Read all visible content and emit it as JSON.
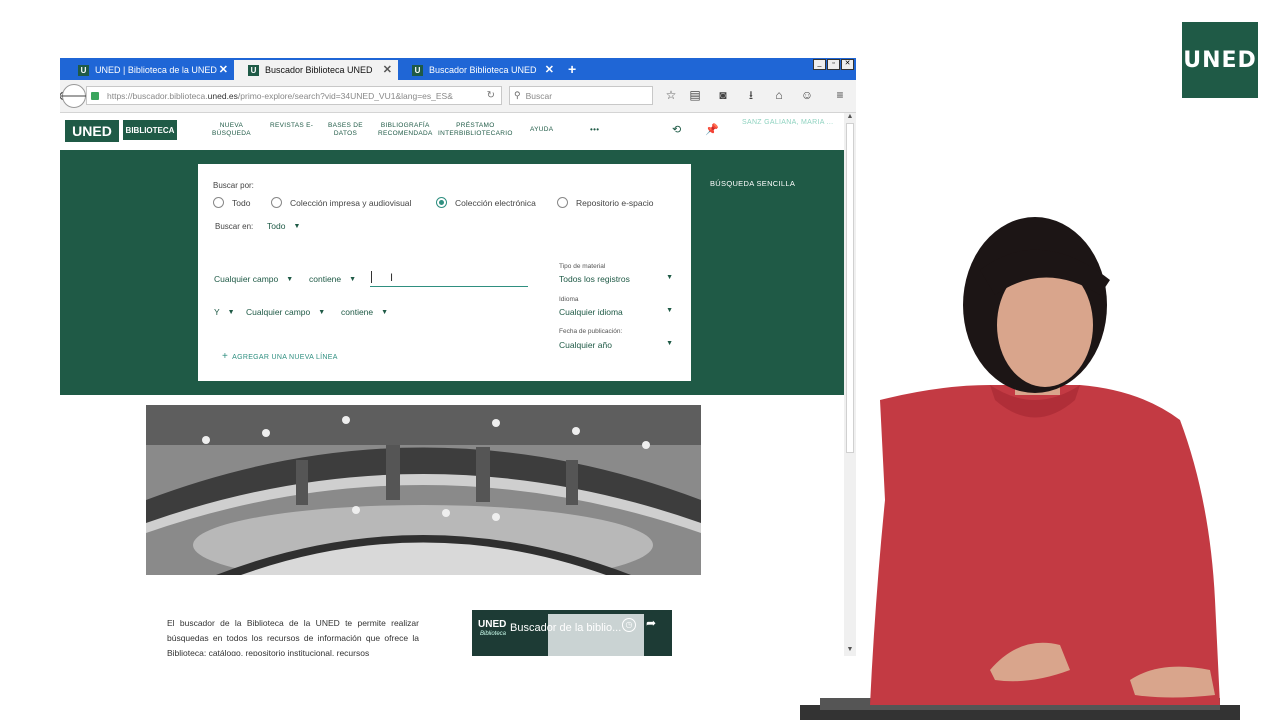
{
  "corner_logo": {
    "text": "UNED"
  },
  "browser": {
    "tabs": [
      {
        "label": "UNED | Biblioteca de la UNED",
        "favicon": "U",
        "close": "✕"
      },
      {
        "label": "Buscador Biblioteca UNED",
        "favicon": "U",
        "close": "✕"
      },
      {
        "label": "Buscador Biblioteca UNED",
        "favicon": "U",
        "close": "✕"
      }
    ],
    "new_tab": "+",
    "url_prefix": "https://buscador.biblioteca.",
    "url_domain": "uned.es",
    "url_suffix": "/primo-explore/search?vid=34UNED_VU1&lang=es_ES&",
    "search_placeholder": "Buscar"
  },
  "header": {
    "logo_uned": "UNED",
    "logo_biblioteca": "BIBLIOTECA",
    "nav": [
      {
        "line1": "NUEVA",
        "line2": "BÚSQUEDA"
      },
      {
        "line1": "REVISTAS E-",
        "line2": ""
      },
      {
        "line1": "BASES DE",
        "line2": "DATOS"
      },
      {
        "line1": "BIBLIOGRAFÍA",
        "line2": "RECOMENDADA"
      },
      {
        "line1": "PRÉSTAMO",
        "line2": "INTERBIBLIOTECARIO"
      },
      {
        "line1": "AYUDA",
        "line2": ""
      }
    ],
    "more": "•••",
    "user": "SANZ GALIANA, MARIA ..."
  },
  "search": {
    "buscar_por_label": "Buscar por:",
    "scopes": [
      {
        "label": "Todo",
        "selected": false
      },
      {
        "label": "Colección impresa y audiovisual",
        "selected": false
      },
      {
        "label": "Colección electrónica",
        "selected": true
      },
      {
        "label": "Repositorio e-spacio",
        "selected": false
      }
    ],
    "buscar_en_label": "Buscar en:",
    "buscar_en_value": "Todo",
    "row1": {
      "field": "Cualquier campo",
      "operator": "contiene",
      "value": ""
    },
    "row2": {
      "boolean": "Y",
      "field": "Cualquier campo",
      "operator": "contiene"
    },
    "add_line": "AGREGAR UNA NUEVA LÍNEA",
    "material_label": "Tipo de material",
    "material_value": "Todos los registros",
    "language_label": "Idioma",
    "language_value": "Cualquier idioma",
    "date_label": "Fecha de publicación:",
    "date_value": "Cualquier año",
    "simple_search": "BÚSQUEDA SENCILLA"
  },
  "description": "El buscador de la Biblioteca de la UNED te permite realizar búsquedas en todos los recursos de información que ofrece la Biblioteca: catálogo, repositorio institucional, recursos",
  "video": {
    "logo": "UNED",
    "sublogo": "Biblioteca",
    "title": "Buscador de la biblio..."
  }
}
